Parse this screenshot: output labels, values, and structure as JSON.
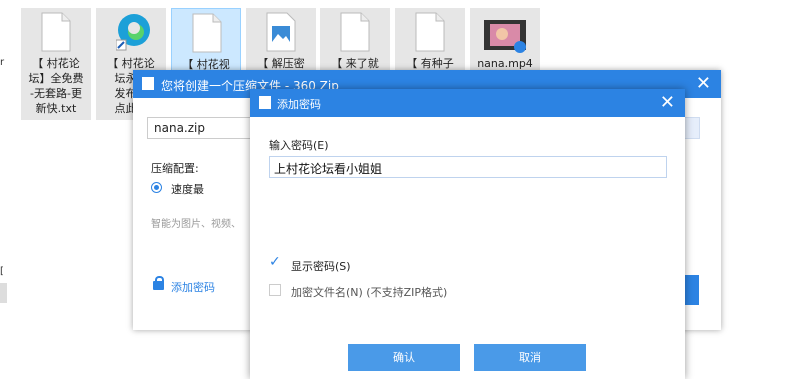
{
  "desktop": {
    "items": [
      {
        "label": "【 村花论\n坛】全免费\n-无套路-更\n新快.txt",
        "icon": "text-file-icon"
      },
      {
        "label": "【 村花论\n坛永久\n发布页\n点此达",
        "icon": "edge-icon"
      },
      {
        "label": "【 村花视",
        "icon": "text-file-icon"
      },
      {
        "label": "【 解压密",
        "icon": "image-file-icon"
      },
      {
        "label": "【 来了就",
        "icon": "text-file-icon"
      },
      {
        "label": "【 有种子",
        "icon": "text-file-icon"
      },
      {
        "label": "nana.mp4",
        "icon": "video-file-icon"
      }
    ],
    "edge_text_1": "r",
    "edge_text_2": "["
  },
  "zip_dialog": {
    "title": "您将创建一个压缩文件 - 360 Zip",
    "close": "✕",
    "filename": "nana.zip",
    "config_label": "压缩配置:",
    "speed_option": "速度最",
    "hint": "智能为图片、视频、",
    "add_password": "添加密码"
  },
  "password_dialog": {
    "title": "添加密码",
    "close": "✕",
    "input_label": "输入密码(E)",
    "password_value": "上村花论坛看小姐姐",
    "show_password": "显示密码(S)",
    "show_password_checked": true,
    "encrypt_names": "加密文件名(N) (不支持ZIP格式)",
    "encrypt_names_checked": false,
    "ok": "确认",
    "cancel": "取消"
  },
  "colors": {
    "accent": "#2c83e3",
    "button": "#4a9ae8"
  }
}
